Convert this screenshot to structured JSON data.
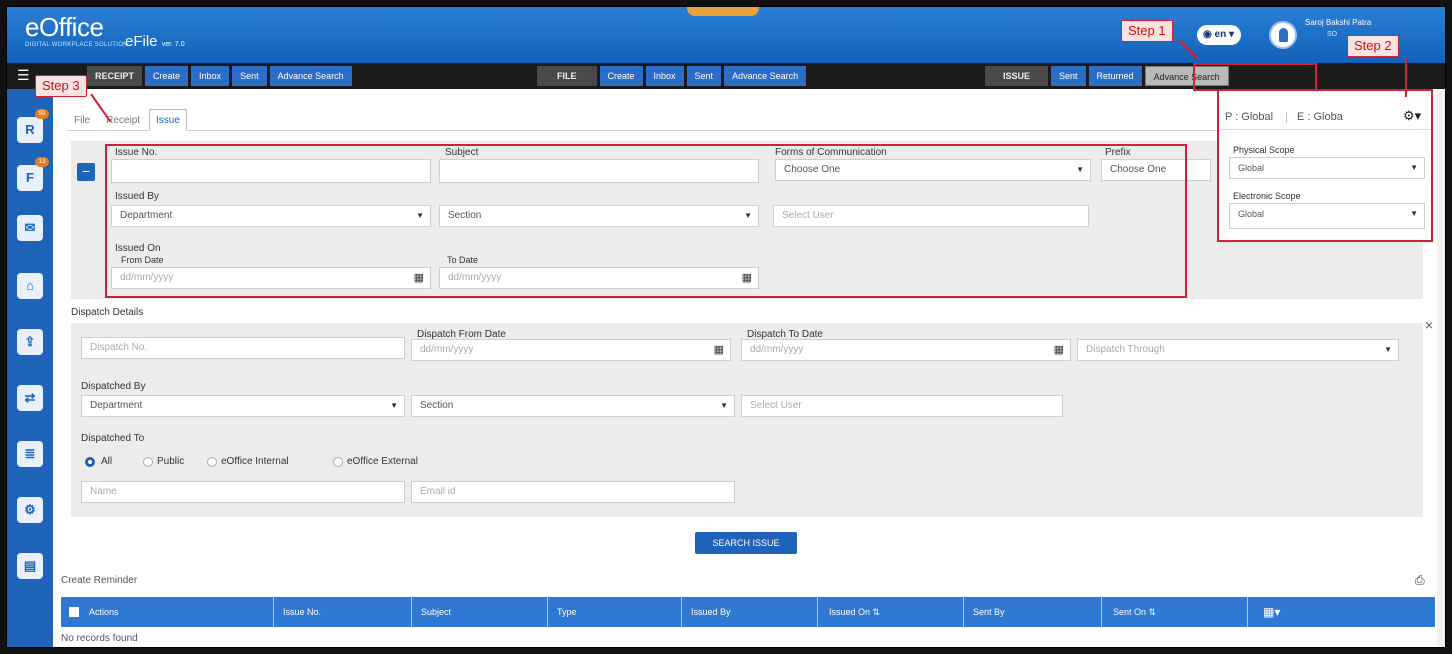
{
  "header": {
    "logo": "eOffice",
    "logo_sub": "DIGITAL WORKPLACE SOLUTION",
    "app": "eFile",
    "version": "ver. 7.0",
    "lang": "en",
    "user_name": "Saroj Bakshi Patra",
    "user_desig": "SO"
  },
  "nav": {
    "receipt_group": [
      "RECEIPT",
      "Create",
      "Inbox",
      "Sent",
      "Advance Search"
    ],
    "file_group": [
      "FILE",
      "Create",
      "Inbox",
      "Sent",
      "Advance Search"
    ],
    "issue_group": [
      "ISSUE",
      "Sent",
      "Returned",
      "Advance Search"
    ]
  },
  "sidebar": {
    "badges": [
      "99",
      "13"
    ]
  },
  "tabs": [
    "File",
    "Receipt",
    "Issue"
  ],
  "scope": {
    "summary_p": "P : Global",
    "summary_e": "E : Globa",
    "physical_label": "Physical Scope",
    "physical_value": "Global",
    "electronic_label": "Electronic Scope",
    "electronic_value": "Global"
  },
  "steps": [
    "Step 1",
    "Step 2",
    "Step 3"
  ],
  "issue_form": {
    "issue_no": "Issue No.",
    "subject": "Subject",
    "form_label": "Forms of Communication",
    "form_value": "Choose One",
    "prefix_label": "Prefix",
    "prefix_value": "Choose One",
    "issued_by": "Issued By",
    "dept": "Department",
    "section": "Section",
    "select_user": "Select User",
    "issued_on": "Issued On",
    "from_date": "From Date",
    "to_date": "To Date",
    "date_ph": "dd/mm/yyyy"
  },
  "dispatch": {
    "title": "Dispatch Details",
    "dispatch_no": "Dispatch No.",
    "from_label": "Dispatch From Date",
    "to_label": "Dispatch To Date",
    "date_ph": "dd/mm/yyyy",
    "through": "Dispatch Through",
    "by_label": "Dispatched By",
    "dept": "Department",
    "section": "Section",
    "select_user": "Select User",
    "to_title": "Dispatched To",
    "radios": [
      "All",
      "Public",
      "eOffice Internal",
      "eOffice External"
    ],
    "name": "Name",
    "email": "Email id",
    "close": "×"
  },
  "search_button": "SEARCH ISSUE",
  "reminder": "Create Reminder",
  "table": {
    "columns": [
      "Actions",
      "Issue No.",
      "Subject",
      "Type",
      "Issued By",
      "Issued On ⇅",
      "Sent By",
      "Sent On ⇅"
    ],
    "empty": "No records found"
  }
}
